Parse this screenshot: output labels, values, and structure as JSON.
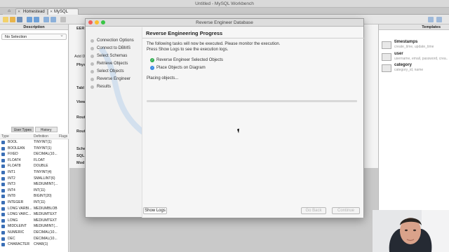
{
  "window": {
    "title": "Untitled - MySQL Workbench"
  },
  "tabs": [
    {
      "label": "Homestead"
    },
    {
      "label": "MySQL Model"
    }
  ],
  "left_panel": {
    "header": "Description",
    "selection": "No Selection",
    "tabs": [
      "User Types",
      "History"
    ],
    "columns": [
      "Type",
      "Definition",
      "Flags"
    ],
    "types": [
      {
        "name": "BOOL",
        "definition": "TINYINT(1)"
      },
      {
        "name": "BOOLEAN",
        "definition": "TINYINT(1)"
      },
      {
        "name": "FIXED",
        "definition": "DECIMAL(10..."
      },
      {
        "name": "FLOAT4",
        "definition": "FLOAT"
      },
      {
        "name": "FLOAT8",
        "definition": "DOUBLE"
      },
      {
        "name": "INT1",
        "definition": "TINYINT(4)"
      },
      {
        "name": "INT2",
        "definition": "SMALLINT(6)"
      },
      {
        "name": "INT3",
        "definition": "MEDIUMINT(..."
      },
      {
        "name": "INT4",
        "definition": "INT(11)"
      },
      {
        "name": "INT8",
        "definition": "BIGINT(20)"
      },
      {
        "name": "INTEGER",
        "definition": "INT(11)"
      },
      {
        "name": "LONG VARBI...",
        "definition": "MEDIUMBLOB"
      },
      {
        "name": "LONG VARC...",
        "definition": "MEDIUMTEXT"
      },
      {
        "name": "LONG",
        "definition": "MEDIUMTEXT"
      },
      {
        "name": "MIDDLEINT",
        "definition": "MEDIUMINT(..."
      },
      {
        "name": "NUMERIC",
        "definition": "DECIMAL(10..."
      },
      {
        "name": "DEC",
        "definition": "DECIMAL(10..."
      },
      {
        "name": "CHARACTER",
        "definition": "CHAR(1)"
      }
    ]
  },
  "center": {
    "labels": [
      "EER",
      "Add D",
      "Phys",
      "Tabl",
      "View",
      "Rout",
      "Rout",
      "Sche",
      "SQL",
      "Mod"
    ]
  },
  "right_panel": {
    "header": "Templates",
    "templates": [
      {
        "name": "timestamps",
        "desc": "create_time, update_time"
      },
      {
        "name": "user",
        "desc": "username, email, password, crea..."
      },
      {
        "name": "category",
        "desc": "category_id, name"
      }
    ]
  },
  "dialog": {
    "title": "Reverse Engineer Database",
    "steps": [
      "Connection Options",
      "Connect to DBMS",
      "Select Schemas",
      "Retrieve Objects",
      "Select Objects",
      "Reverse Engineer",
      "Results"
    ],
    "page_title": "Reverse Engineering Progress",
    "description_line1": "The following tasks will now be executed. Please monitor the execution.",
    "description_line2": "Press Show Logs to see the execution logs.",
    "tasks": [
      {
        "label": "Reverse Engineer Selected Objects",
        "status": "done"
      },
      {
        "label": "Place Objects on Diagram",
        "status": "running"
      }
    ],
    "status_text": "Placing objects...",
    "progress": 0,
    "buttons": {
      "show_logs": "Show Logs",
      "go_back": "Go Back",
      "continue": "Continue"
    }
  },
  "colors": {
    "accent": "#3b89e3",
    "done": "#2fae4e",
    "running": "#3b89e3"
  }
}
